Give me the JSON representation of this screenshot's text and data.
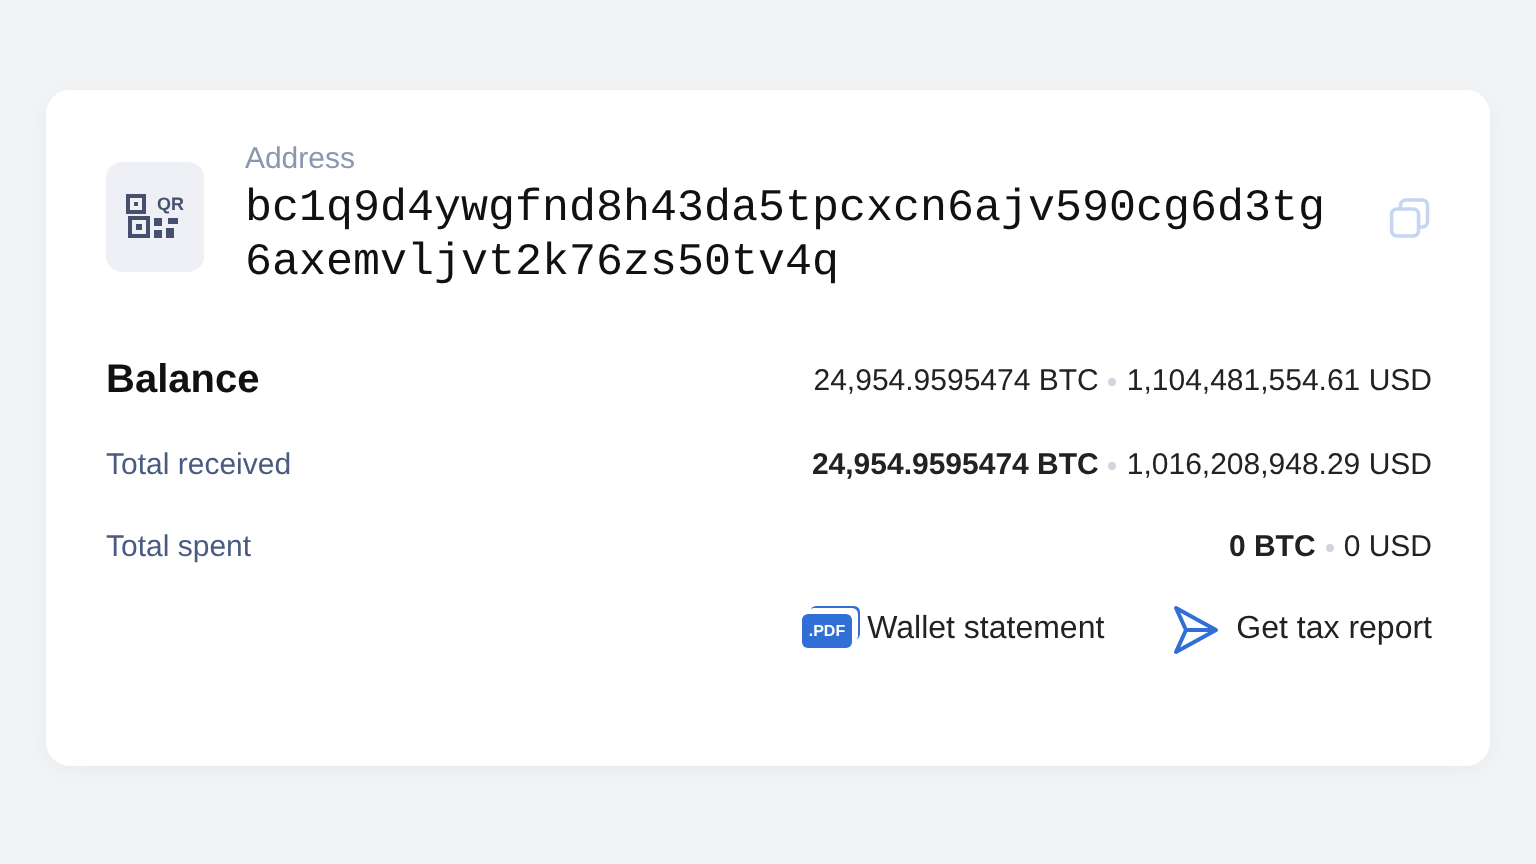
{
  "address": {
    "label": "Address",
    "value": "bc1q9d4ywgfnd8h43da5tpcxcn6ajv590cg6d3tg6axemvljvt2k76zs50tv4q",
    "qr_label": "QR"
  },
  "rows": [
    {
      "kind": "primary",
      "label": "Balance",
      "btc": "24,954.9595474 BTC",
      "usd": "1,104,481,554.61 USD"
    },
    {
      "kind": "secondary",
      "label": "Total received",
      "btc": "24,954.9595474 BTC",
      "usd": "1,016,208,948.29 USD"
    },
    {
      "kind": "secondary",
      "label": "Total spent",
      "btc": "0 BTC",
      "usd": "0 USD"
    }
  ],
  "actions": [
    {
      "kind": "pdf",
      "icon_label": ".PDF",
      "label": "Wallet statement"
    },
    {
      "kind": "send",
      "label": "Get tax report"
    }
  ]
}
